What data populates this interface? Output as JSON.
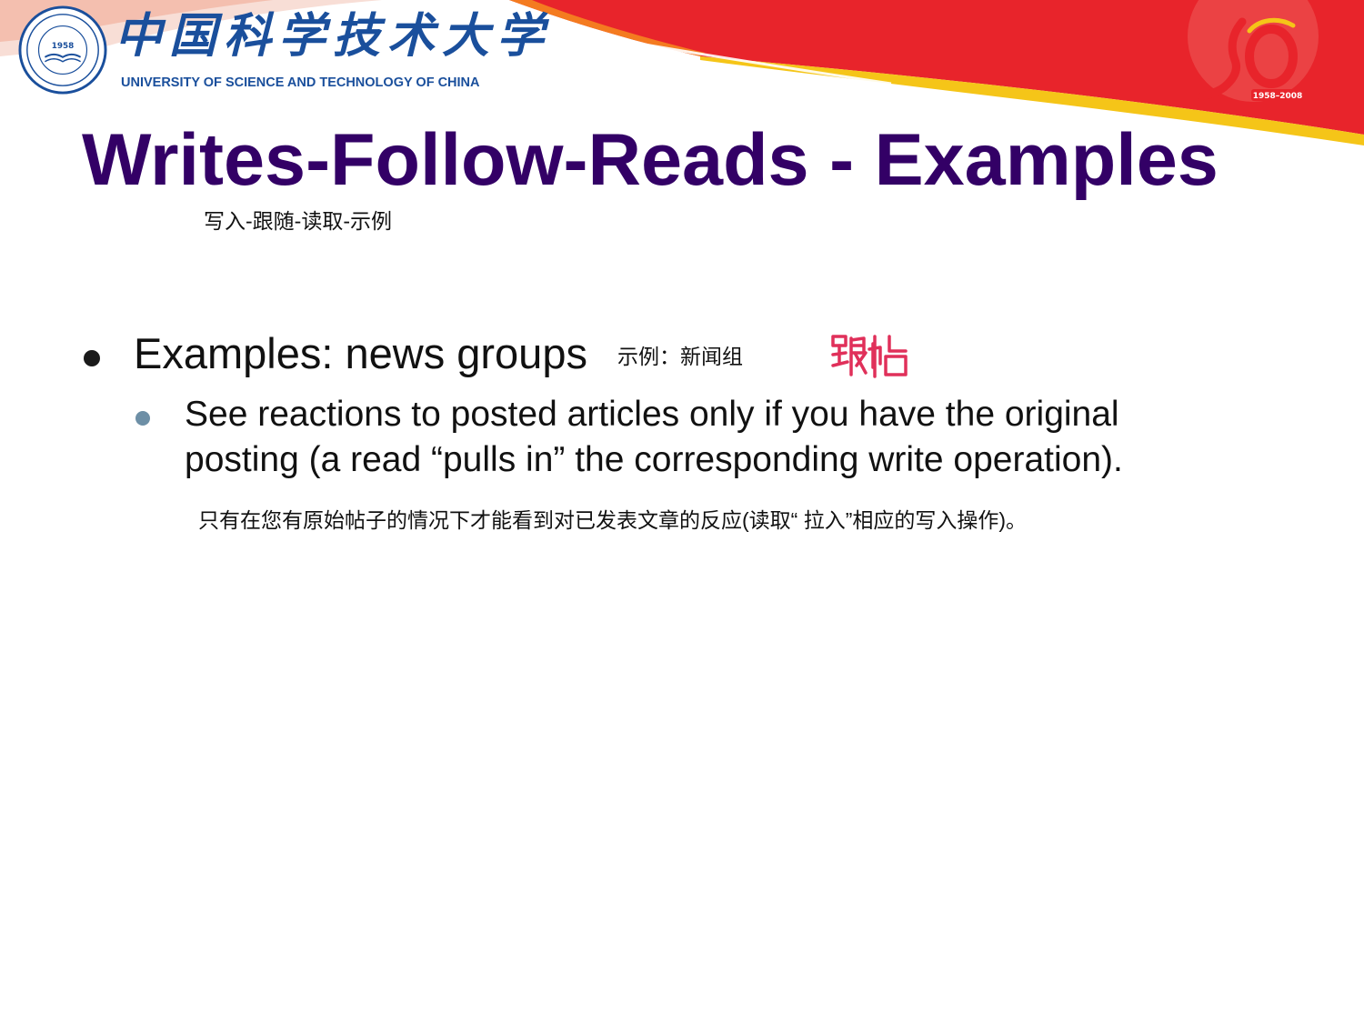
{
  "header": {
    "school_name_cn": "中国科学技术大学",
    "school_name_en": "UNIVERSITY OF SCIENCE AND TECHNOLOGY OF CHINA",
    "seal_year": "1958",
    "anniversary_years": "1958–2008",
    "colors": {
      "brand_blue": "#1a4f9c",
      "banner_red": "#e8242b",
      "banner_orange": "#f47b20",
      "banner_yellow": "#f5c518"
    }
  },
  "slide": {
    "title": "Writes-Follow-Reads - Examples",
    "title_note": "写入-跟随-读取-示例",
    "title_color": "#330066",
    "bullet": {
      "text": "Examples: news groups",
      "note": "示例：新闻组",
      "handwritten_annotation": "跟帖"
    },
    "sub_bullet": {
      "line1": "See reactions to posted articles only if you have the original",
      "line2": "posting (a read “pulls in” the corresponding write operation).",
      "note": "只有在您有原始帖子的情况下才能看到对已发表文章的反应(读取“ 拉入”相应的写入操作)。",
      "bullet_color": "#6d8fa6"
    }
  }
}
